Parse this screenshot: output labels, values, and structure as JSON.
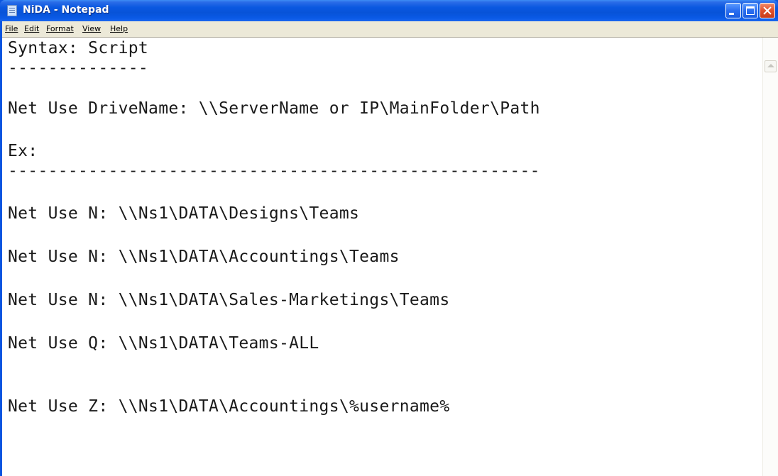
{
  "window": {
    "title": "NiDA - Notepad"
  },
  "menu": {
    "items": [
      "File",
      "Edit",
      "Format",
      "View",
      "Help"
    ]
  },
  "editor": {
    "lines": [
      "Syntax: Script",
      "--------------",
      "",
      "Net Use DriveName: \\\\ServerName or IP\\MainFolder\\Path",
      "",
      "Ex:",
      "-----------------------------------------------------",
      "",
      "Net Use N: \\\\Ns1\\DATA\\Designs\\Teams",
      "",
      "Net Use N: \\\\Ns1\\DATA\\Accountings\\Teams",
      "",
      "Net Use N: \\\\Ns1\\DATA\\Sales-Marketings\\Teams",
      "",
      "Net Use Q: \\\\Ns1\\DATA\\Teams-ALL",
      "",
      "",
      "Net Use Z: \\\\Ns1\\DATA\\Accountings\\%username%"
    ]
  },
  "colors": {
    "title_bar": "#0a58e0",
    "menu_bar": "#ece9d8",
    "close_button": "#e0502a"
  },
  "icons": {
    "app": "notepad-icon",
    "minimize": "minimize-icon",
    "maximize": "maximize-icon",
    "close": "close-icon",
    "scroll_up": "scroll-up-arrow-icon"
  }
}
